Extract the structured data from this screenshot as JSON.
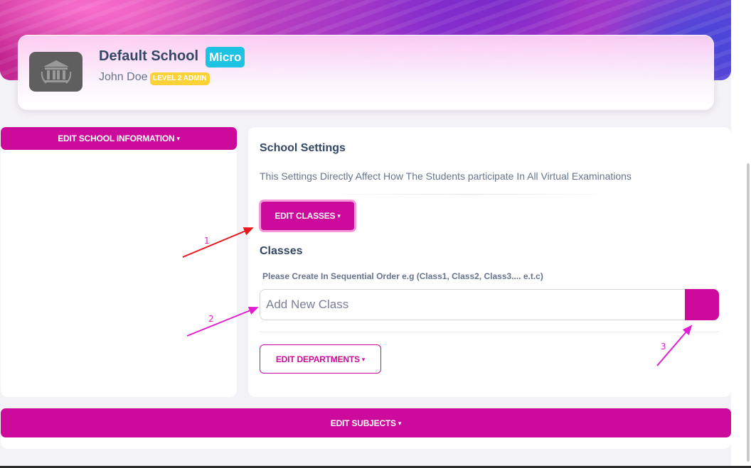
{
  "profile": {
    "school_name": "Default School",
    "plan_badge": "Micro",
    "user_name": "John Doe",
    "role_badge": "LEVEL 2 ADMIN",
    "logo_icon": "school-building-icon"
  },
  "left_panel": {
    "edit_school_label": "EDIT SCHOOL INFORMATION"
  },
  "settings": {
    "title": "School Settings",
    "description": "This Settings Directly Affect How The Students participate In All Virtual Examinations",
    "edit_classes_label": "EDIT CLASSES",
    "classes_title": "Classes",
    "classes_hint": "Please Create In Sequential Order e.g (Class1, Class2, Class3.... e.t.c)",
    "class_input_placeholder": "Add New Class",
    "class_input_value": "",
    "edit_departments_label": "EDIT DEPARTMENTS"
  },
  "bottom": {
    "edit_subjects_label": "EDIT SUBJECTS"
  },
  "annotations": [
    {
      "label": "1",
      "color": "#e8151a"
    },
    {
      "label": "2",
      "color": "#e020d0"
    },
    {
      "label": "3",
      "color": "#e020d0"
    }
  ],
  "colors": {
    "accent": "#cc0b9d",
    "plan_badge": "#1ec3e3",
    "role_badge": "#fbd238",
    "heading": "#344767"
  }
}
